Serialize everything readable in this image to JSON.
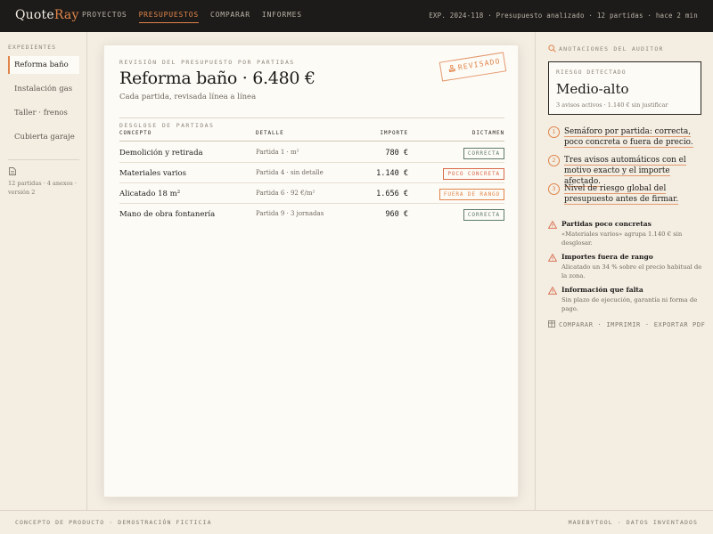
{
  "brand": {
    "quote": "Quote",
    "ray": "Ray"
  },
  "nav": [
    "PROYECTOS",
    "PRESUPUESTOS",
    "COMPARAR",
    "INFORMES"
  ],
  "nav_active": "PRESUPUESTOS",
  "topbar_meta": "EXP. 2024-118 · Presupuesto analizado · 12 partidas · hace 2 min",
  "sidebar": {
    "label": "EXPEDIENTES",
    "items": [
      "Reforma baño",
      "Instalación gas",
      "Taller · frenos",
      "Cubierta garaje"
    ],
    "active_index": 0,
    "meta": "12 partidas · 4 anexos · versión 2"
  },
  "sheet": {
    "kicker": "REVISIÓN DEL PRESUPUESTO POR PARTIDAS",
    "title": "Reforma baño · 6.480 €",
    "subtitle": "Cada partida, revisada línea a línea",
    "stamp": "REVISADO",
    "section_label": "DESGLOSE DE PARTIDAS",
    "columns": [
      "CONCEPTO",
      "DETALLE",
      "IMPORTE",
      "DICTAMEN"
    ],
    "rows": [
      {
        "concept": "Demolición y retirada",
        "detail": "Partida 1 · m²",
        "amount": "780 €",
        "verdict": "CORRECTA",
        "status": "ok"
      },
      {
        "concept": "Materiales varios",
        "detail": "Partida 4 · sin detalle",
        "amount": "1.140 €",
        "verdict": "POCO CONCRETA",
        "status": "warn"
      },
      {
        "concept": "Alicatado 18 m²",
        "detail": "Partida 6 · 92 €/m²",
        "amount": "1.656 €",
        "verdict": "FUERA DE RANGO",
        "status": "range"
      },
      {
        "concept": "Mano de obra fontanería",
        "detail": "Partida 9 · 3 jornadas",
        "amount": "960 €",
        "verdict": "CORRECTA",
        "status": "ok"
      }
    ]
  },
  "panel": {
    "header": "ANOTACIONES DEL AUDITOR",
    "risk_label": "RIESGO DETECTADO",
    "risk_value": "Medio-alto",
    "risk_meta": "3 avisos activos · 1.140 € sin justificar",
    "points": [
      {
        "n": "1",
        "text": "Semáforo por partida: correcta, poco concreta o fuera de precio."
      },
      {
        "n": "2",
        "text": "Tres avisos automáticos con el motivo exacto y el importe afectado."
      },
      {
        "n": "3",
        "text": "Nivel de riesgo global del presupuesto antes de firmar."
      }
    ],
    "warnings": [
      {
        "title": "Partidas poco concretas",
        "desc": "«Materiales varios» agrupa 1.140 € sin desglosar."
      },
      {
        "title": "Importes fuera de rango",
        "desc": "Alicatado un 34 % sobre el precio habitual de la zona."
      },
      {
        "title": "Información que falta",
        "desc": "Sin plazo de ejecución, garantía ni forma de pago."
      }
    ],
    "actions": [
      "COMPARAR",
      "IMPRIMIR",
      "EXPORTAR PDF"
    ]
  },
  "footer": {
    "left": "CONCEPTO DE PRODUCTO · DEMOSTRACIÓN FICTICIA",
    "right": "MADEBYTOOL · DATOS INVENTADOS"
  },
  "colors": {
    "accent": "#e0844a",
    "ok": "#5e7a6c",
    "warn": "#d9694a",
    "topbar": "#1d1b19",
    "paper": "#fdfbf6"
  },
  "icons": [
    "document-icon",
    "stamp-icon",
    "search-icon",
    "warning-icon",
    "compare-icon"
  ]
}
